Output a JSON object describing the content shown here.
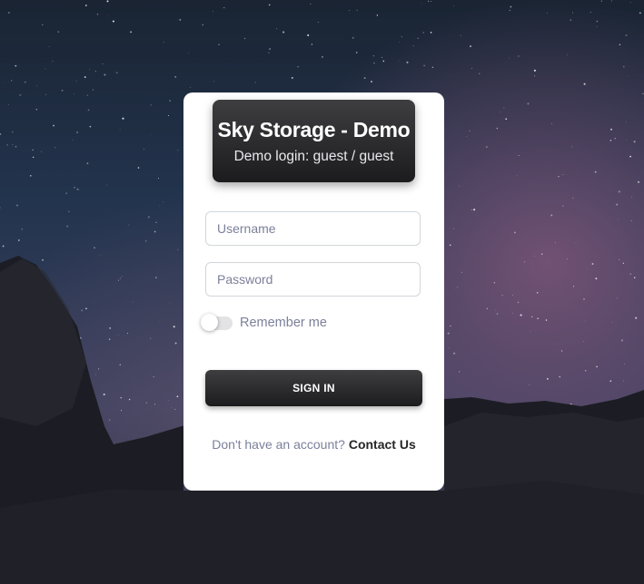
{
  "header": {
    "title": "Sky Storage - Demo",
    "subtitle": "Demo login: guest / guest"
  },
  "form": {
    "username_placeholder": "Username",
    "username_value": "",
    "password_placeholder": "Password",
    "password_value": "",
    "remember_label": "Remember me",
    "remember_checked": false,
    "signin_label": "SIGN IN"
  },
  "footer": {
    "text": "Don't have an account?",
    "link_label": "Contact Us"
  },
  "colors": {
    "header_gradient_top": "#3e3d40",
    "header_gradient_bottom": "#1c1b1e",
    "muted_text": "#7b809a",
    "link_text": "#262628"
  }
}
